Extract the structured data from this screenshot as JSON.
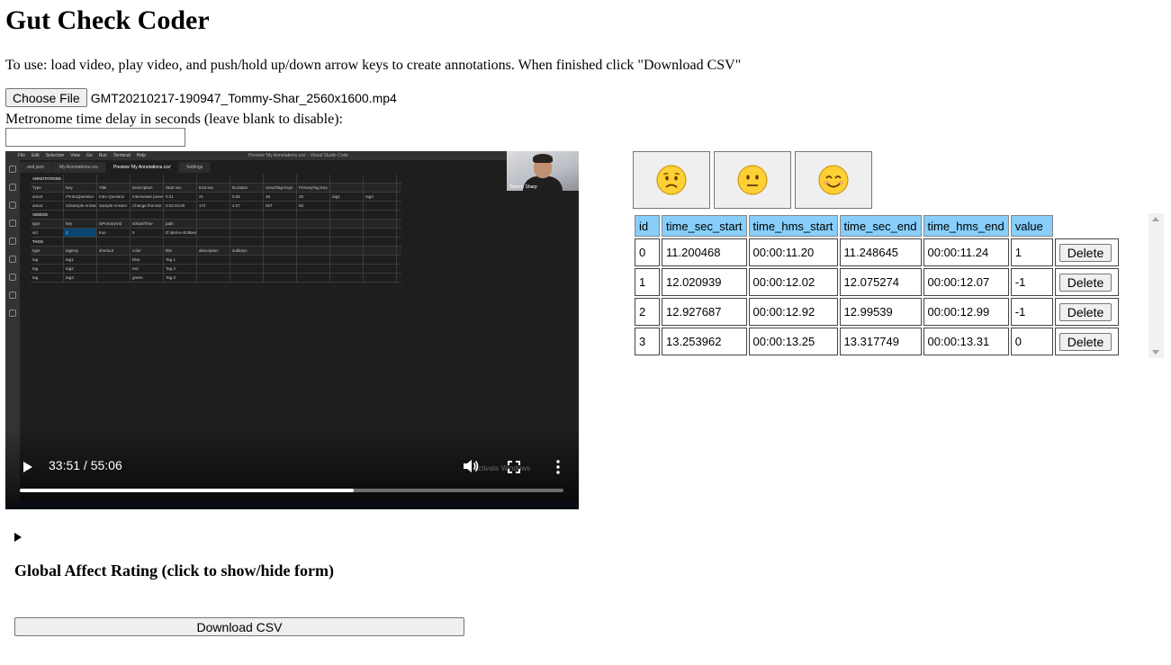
{
  "page": {
    "title": "Gut Check Coder",
    "instructions": "To use: load video, play video, and push/hold up/down arrow keys to create annotations. When finished click \"Download CSV\""
  },
  "file_input": {
    "button_label": "Choose File",
    "file_name": "GMT20210217-190947_Tommy-Shar_2560x1600.mp4"
  },
  "metronome": {
    "label": "Metronome time delay in seconds (leave blank to disable):",
    "value": ""
  },
  "video": {
    "time_display": "33:51 / 55:06",
    "progress_fraction": 0.614,
    "screen_content": {
      "menu": [
        "File",
        "Edit",
        "Selection",
        "View",
        "Go",
        "Run",
        "Terminal",
        "Help"
      ],
      "window_title": "Preview 'My Annotations.csv' - Visual Studio Code",
      "tabs": [
        "and.json",
        "My Annotations.csv",
        "Preview 'My Annotations.csv'",
        "Settings"
      ],
      "webcam_name": "Tommy Sharp",
      "grid_rows": [
        {
          "type": "sect",
          "cells": [
            "ANNOTATIONS"
          ]
        },
        {
          "type": "hdr",
          "cells": [
            "Type",
            "Key",
            "Title",
            "Description",
            "Start sec",
            "End sec",
            "Duration",
            "AnnotTag Keys",
            "PrimaryTag Key"
          ]
        },
        {
          "type": "row",
          "cells": [
            "annot",
            "ITIntroQuestion",
            "Intro Question",
            "Interviewer poses",
            "0:21",
            "21",
            "0.05",
            "46",
            "25",
            "tag1",
            "tag3"
          ]
        },
        {
          "type": "row",
          "cells": [
            "annot",
            "34Sample Answer",
            "Sample Answer",
            "Change this text",
            "0:02:34.00",
            "174",
            "4:27",
            "267",
            "93"
          ]
        },
        {
          "type": "sect",
          "cells": [
            "VIDEOS"
          ]
        },
        {
          "type": "hdr",
          "cells": [
            "type",
            "key",
            "isPrimaryVid",
            "isStartTime",
            "path"
          ]
        },
        {
          "type": "row",
          "cells": [
            "vid",
            "2",
            "true",
            "0",
            "D:\\demo-4\\c9be46"
          ]
        },
        {
          "type": "sect",
          "cells": [
            "TAGS"
          ]
        },
        {
          "type": "hdr",
          "cells": [
            "type",
            "tagKey",
            "shortcut",
            "color",
            "title",
            "description",
            "subkeys"
          ]
        },
        {
          "type": "row",
          "cells": [
            "tag",
            "tag1",
            "",
            "blue",
            "Tag 1"
          ]
        },
        {
          "type": "row",
          "cells": [
            "tag",
            "tag2",
            "",
            "red",
            "Tag 2"
          ]
        },
        {
          "type": "row",
          "cells": [
            "tag",
            "tag3",
            "",
            "green",
            "Tag 3"
          ]
        }
      ],
      "watermark": "Activate Windows"
    }
  },
  "rating_buttons": [
    {
      "name": "negative",
      "icon": "worried-face-icon"
    },
    {
      "name": "neutral",
      "icon": "neutral-face-icon"
    },
    {
      "name": "positive",
      "icon": "smiling-face-icon"
    }
  ],
  "annotations_table": {
    "header_color": "#87cefa",
    "columns": [
      "id",
      "time_sec_start",
      "time_hms_start",
      "time_sec_end",
      "time_hms_end",
      "value"
    ],
    "rows": [
      {
        "id": "0",
        "time_sec_start": "11.200468",
        "time_hms_start": "00:00:11.20",
        "time_sec_end": "11.248645",
        "time_hms_end": "00:00:11.24",
        "value": "1",
        "delete_label": "Delete"
      },
      {
        "id": "1",
        "time_sec_start": "12.020939",
        "time_hms_start": "00:00:12.02",
        "time_sec_end": "12.075274",
        "time_hms_end": "00:00:12.07",
        "value": "-1",
        "delete_label": "Delete"
      },
      {
        "id": "2",
        "time_sec_start": "12.927687",
        "time_hms_start": "00:00:12.92",
        "time_sec_end": "12.99539",
        "time_hms_end": "00:00:12.99",
        "value": "-1",
        "delete_label": "Delete"
      },
      {
        "id": "3",
        "time_sec_start": "13.253962",
        "time_hms_start": "00:00:13.25",
        "time_sec_end": "13.317749",
        "time_hms_end": "00:00:13.31",
        "value": "0",
        "delete_label": "Delete"
      }
    ]
  },
  "global_affect": {
    "summary": "Global Affect Rating (click to show/hide form)"
  },
  "download": {
    "label": "Download CSV"
  }
}
